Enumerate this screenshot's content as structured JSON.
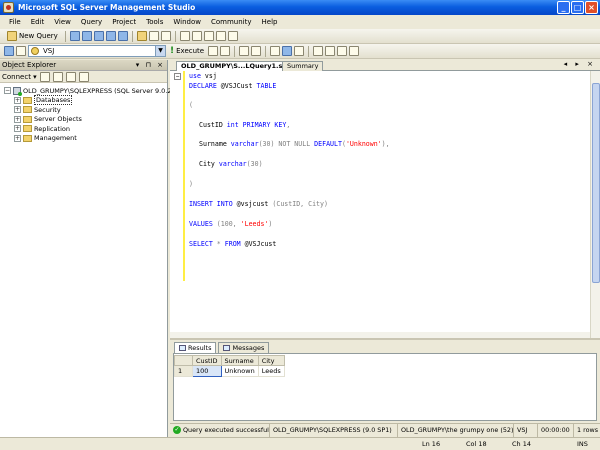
{
  "window": {
    "title": "Microsoft SQL Server Management Studio"
  },
  "menu": [
    "File",
    "Edit",
    "View",
    "Query",
    "Project",
    "Tools",
    "Window",
    "Community",
    "Help"
  ],
  "toolbar": {
    "new_query_label": "New Query",
    "database": "VSJ",
    "execute_label": "Execute"
  },
  "object_explorer": {
    "title": "Object Explorer",
    "header_controls": "▾ ⊓ ×",
    "connect_label": "Connect ▾",
    "server": "OLD_GRUMPY\\SQLEXPRESS (SQL Server 9.0.2047",
    "nodes": [
      "Databases",
      "Security",
      "Server Objects",
      "Replication",
      "Management"
    ]
  },
  "editor": {
    "tab_active": "OLD_GRUMPY\\S...LQuery1.sql*",
    "tab_summary": "Summary",
    "tab_controls": "◂ ▸ ×",
    "lines": {
      "l1_kw": "use",
      "l1_rest": " vsj",
      "l2_kw": "DECLARE",
      "l2_var": " @VSJCust ",
      "l2_kw2": "TABLE",
      "l3": "(",
      "l4_col": "CustID ",
      "l4_kw": "int PRIMARY KEY",
      "l4_rest": ",",
      "l5_col": "Surname ",
      "l5_kw": "varchar",
      "l5_a": "(30) ",
      "l5_g": "NOT NULL",
      "l5_kw2": " DEFAULT",
      "l5_p": "(",
      "l5_str": "'Unknown'",
      "l5_end": "),",
      "l6_col": "City ",
      "l6_kw": "varchar",
      "l6_a": "(30)",
      "l7": ")",
      "l8_kw": "INSERT INTO",
      "l8_rest": " @vsjcust ",
      "l8_g": "(CustID, City)",
      "l9_kw": "VALUES",
      "l9_a": " (100, ",
      "l9_str": "'Leeds'",
      "l9_end": ")",
      "l10_kw": "SELECT",
      "l10_g": " * ",
      "l10_kw2": "FROM",
      "l10_rest": " @VSJcust"
    }
  },
  "results": {
    "tabs": [
      "Results",
      "Messages"
    ],
    "columns": [
      "CustID",
      "Surname",
      "City"
    ],
    "rows": [
      {
        "num": "1",
        "CustID": "100",
        "Surname": "Unknown",
        "City": "Leeds"
      }
    ]
  },
  "query_status": {
    "message": "Query executed successful...",
    "server": "OLD_GRUMPY\\SQLEXPRESS (9.0 SP1)",
    "user": "OLD_GRUMPY\\the grumpy one (52)",
    "database": "VSJ",
    "elapsed": "00:00:00",
    "rows": "1 rows"
  },
  "status_bar": {
    "ln": "Ln 16",
    "col": "Col 18",
    "ch": "Ch 14",
    "mode": "INS"
  }
}
